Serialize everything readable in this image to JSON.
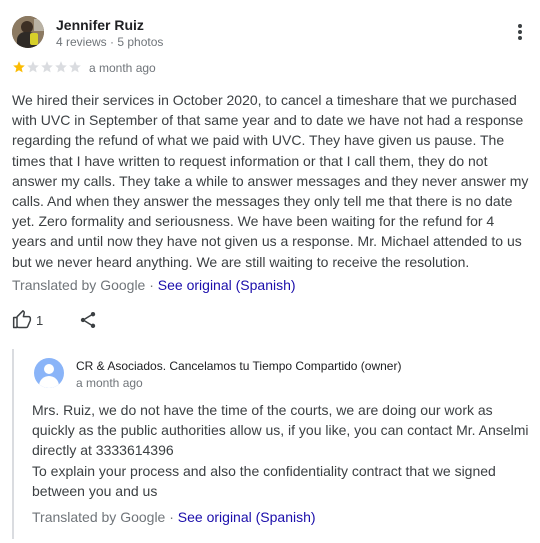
{
  "reviewer": {
    "name": "Jennifer Ruiz",
    "meta": "4 reviews · 5 photos"
  },
  "rating": {
    "stars": 1,
    "max_stars": 5,
    "date": "a month ago",
    "filled_color": "#fbbc04",
    "empty_color": "#dadce0"
  },
  "review": {
    "lines": [
      "We hired their services in October 2020, to cancel a timeshare that we purchased",
      "with UVC in September of that same year and to date we have not had a response",
      "regarding the refund of what we paid with UVC. They have given us pause. The",
      "times that I have written to request information or that I call them, they do not",
      "answer my calls. They take a while to answer messages and they never answer my",
      "calls. And when they answer the messages they only tell me that there is no date",
      "yet. Zero formality and seriousness. We have been waiting for the refund for 4",
      "years and until now they have not given us a response. Mr. Michael attended to us",
      "but we never heard anything. We are still waiting to receive the resolution."
    ],
    "translated_by": "Translated by Google",
    "separator": " · ",
    "see_original": "See original (Spanish)"
  },
  "actions": {
    "like_count": "1",
    "like_icon": "thumb-up-icon",
    "share_icon": "share-icon",
    "more_icon": "more-vert-icon"
  },
  "owner_reply": {
    "name": "CR & Asociados. Cancelamos tu Tiempo Compartido (owner)",
    "date": "a month ago",
    "lines": [
      "Mrs. Ruiz, we do not have the time of the courts, we are doing our work as",
      "quickly as the public authorities allow us, if you like, you can contact Mr. Anselmi",
      "directly at 3333614396",
      "To explain your process and also the confidentiality contract that we signed",
      "between you and us"
    ],
    "translated_by": "Translated by Google",
    "separator": " · ",
    "see_original": "See original (Spanish)"
  },
  "colors": {
    "link": "#1a0dab",
    "secondary_text": "#70757a",
    "owner_avatar": "#8ab4f8"
  }
}
